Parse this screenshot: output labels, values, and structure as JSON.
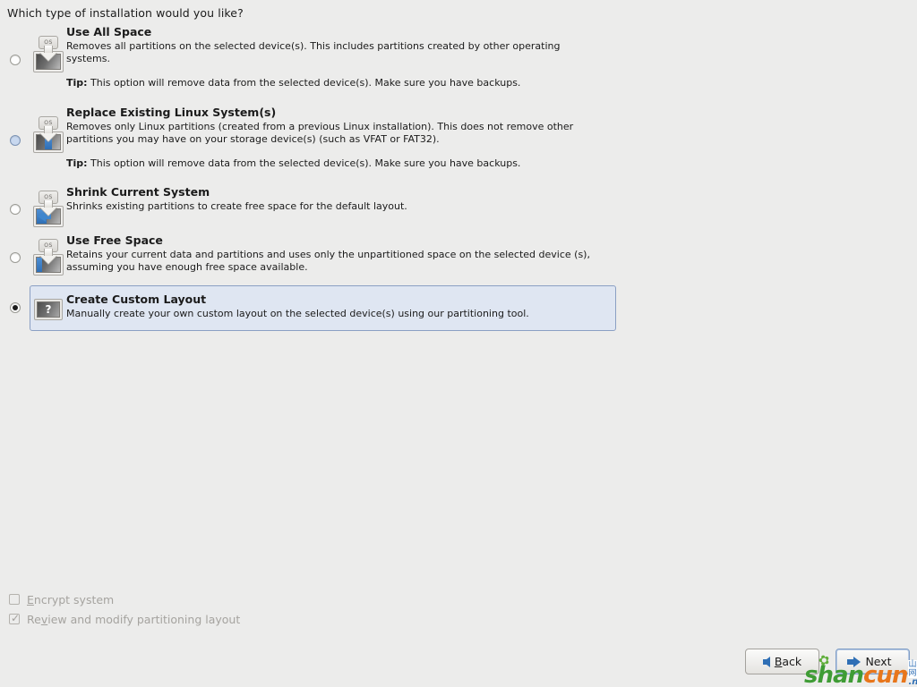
{
  "page": {
    "question": "Which type of installation would you like?",
    "background_color": "#ececeb"
  },
  "options": [
    {
      "id": "use-all-space",
      "title": "Use All Space",
      "description": "Removes all partitions on the selected device(s).  This includes partitions created by other operating systems.",
      "tip_label": "Tip:",
      "tip_text": "This option will remove data from the selected device(s).  Make sure you have backups.",
      "icon": "disk-os-arrow-icon",
      "icon_os_label": "OS",
      "selected": false,
      "hovered": false
    },
    {
      "id": "replace-existing-linux",
      "title": "Replace Existing Linux System(s)",
      "description": "Removes only Linux partitions (created from a previous Linux installation).  This does not remove other partitions you may have on your storage device(s) (such as VFAT or FAT32).",
      "tip_label": "Tip:",
      "tip_text": "This option will remove data from the selected device(s).  Make sure you have backups.",
      "icon": "disk-os-arrow-blue-middle-icon",
      "icon_os_label": "OS",
      "selected": false,
      "hovered": true
    },
    {
      "id": "shrink-current-system",
      "title": "Shrink Current System",
      "description": "Shrinks existing partitions to create free space for the default layout.",
      "tip_label": "",
      "tip_text": "",
      "icon": "disk-os-arrow-blue-left-arrow-icon",
      "icon_os_label": "OS",
      "selected": false,
      "hovered": false
    },
    {
      "id": "use-free-space",
      "title": "Use Free Space",
      "description": "Retains your current data and partitions and uses only the unpartitioned space on the selected device (s), assuming you have enough free space available.",
      "tip_label": "",
      "tip_text": "",
      "icon": "disk-os-arrow-blue-left-bar-icon",
      "icon_os_label": "OS",
      "selected": false,
      "hovered": false
    },
    {
      "id": "create-custom-layout",
      "title": "Create Custom Layout",
      "description": "Manually create your own custom layout on the selected device(s) using our partitioning tool.",
      "tip_label": "",
      "tip_text": "",
      "icon": "question-mark-disk-icon",
      "icon_question_glyph": "?",
      "selected": true,
      "hovered": false
    }
  ],
  "checkboxes": [
    {
      "id": "encrypt-system",
      "label_before": "",
      "label_mnemonic": "E",
      "label_after": "ncrypt system",
      "checked": false,
      "disabled": true
    },
    {
      "id": "review-modify-partitioning",
      "label_before": "Re",
      "label_mnemonic": "v",
      "label_after": "iew and modify partitioning layout",
      "checked": true,
      "disabled": true
    }
  ],
  "buttons": {
    "back": {
      "label_before": "",
      "label_mnemonic": "B",
      "label_after": "ack",
      "icon": "arrow-left-icon",
      "focused": false
    },
    "next": {
      "label_before": "Next",
      "label_mnemonic": "",
      "label_after": "",
      "icon": "arrow-right-icon",
      "focused": true
    }
  },
  "watermark": {
    "part1": "shan",
    "part2": "cun",
    "chinese": "山村网",
    "domain": ".net",
    "color1": "#3f9c35",
    "color2": "#e8761b"
  }
}
